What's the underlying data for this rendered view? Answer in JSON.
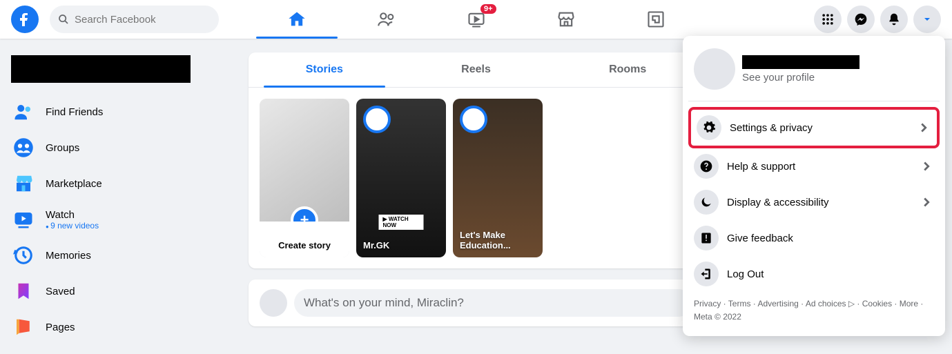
{
  "header": {
    "search_placeholder": "Search Facebook",
    "video_badge": "9+"
  },
  "sidebar": {
    "items": [
      {
        "label": "Find Friends",
        "icon": "friends"
      },
      {
        "label": "Groups",
        "icon": "groups"
      },
      {
        "label": "Marketplace",
        "icon": "marketplace"
      },
      {
        "label": "Watch",
        "icon": "watch",
        "sub": "9 new videos"
      },
      {
        "label": "Memories",
        "icon": "memories"
      },
      {
        "label": "Saved",
        "icon": "saved"
      },
      {
        "label": "Pages",
        "icon": "pages"
      }
    ]
  },
  "feed": {
    "tabs": {
      "stories": "Stories",
      "reels": "Reels",
      "rooms": "Rooms"
    },
    "stories": [
      {
        "title": "Create story"
      },
      {
        "title": "Mr.GK",
        "watch_now": "▶ WATCH NOW"
      },
      {
        "title": "Let's Make Education..."
      }
    ],
    "composer_prompt": "What's on your mind, Miraclin?"
  },
  "dropdown": {
    "profile_sub": "See your profile",
    "items": [
      {
        "label": "Settings & privacy",
        "icon": "gear",
        "chevron": true,
        "highlight": true
      },
      {
        "label": "Help & support",
        "icon": "help",
        "chevron": true
      },
      {
        "label": "Display & accessibility",
        "icon": "moon",
        "chevron": true
      },
      {
        "label": "Give feedback",
        "icon": "feedback"
      },
      {
        "label": "Log Out",
        "icon": "logout"
      }
    ],
    "footer": "Privacy · Terms · Advertising · Ad choices ▷ · Cookies · More · Meta © 2022"
  }
}
